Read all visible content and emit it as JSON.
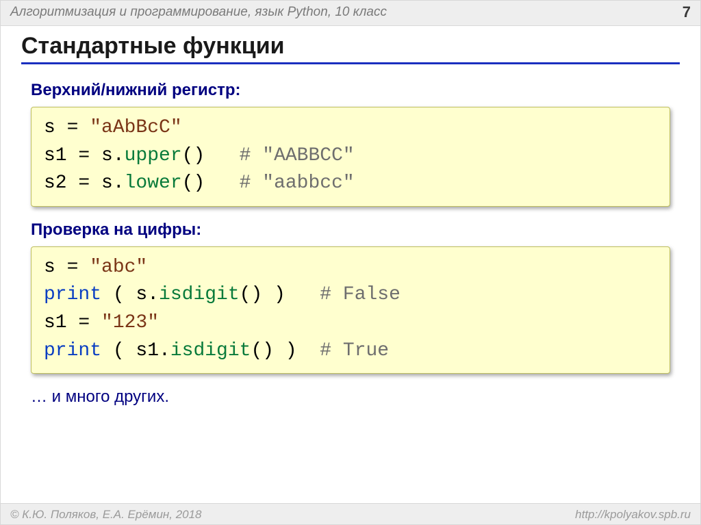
{
  "header": {
    "subject": "Алгоритмизация и программирование, язык Python, 10 класс",
    "page": "7"
  },
  "title": "Стандартные функции",
  "labels": {
    "case": "Верхний/нижний регистр:",
    "digits": "Проверка на цифры:"
  },
  "code1": {
    "l1a": "s = ",
    "l1s": "\"aAbBcC\"",
    "l2a": "s1 = s.",
    "l2m": "upper",
    "l2b": "()   ",
    "l2c": "# \"AABBCC\"",
    "l3a": "s2 = s.",
    "l3m": "lower",
    "l3b": "()   ",
    "l3c": "# \"aabbcc\""
  },
  "code2": {
    "l1a": "s = ",
    "l1s": "\"abc\"",
    "l2p": "print",
    "l2a": " ( s.",
    "l2m": "isdigit",
    "l2b": "() )   ",
    "l2c": "# False",
    "l3a": "s1 = ",
    "l3s": "\"123\"",
    "l4p": "print",
    "l4a": " ( s1.",
    "l4m": "isdigit",
    "l4b": "() )  ",
    "l4c": "# True"
  },
  "note": "… и много других.",
  "footer": {
    "copyright": "© К.Ю. Поляков, Е.А. Ерёмин, 2018",
    "url": "http://kpolyakov.spb.ru"
  }
}
